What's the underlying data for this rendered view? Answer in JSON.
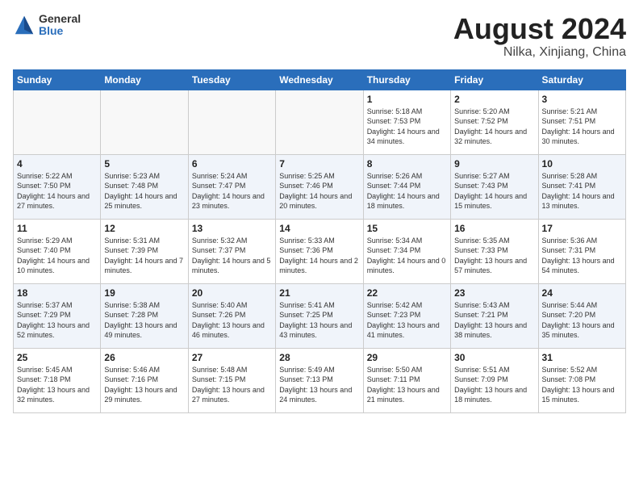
{
  "header": {
    "logo_general": "General",
    "logo_blue": "Blue",
    "month_year": "August 2024",
    "location": "Nilka, Xinjiang, China"
  },
  "days_of_week": [
    "Sunday",
    "Monday",
    "Tuesday",
    "Wednesday",
    "Thursday",
    "Friday",
    "Saturday"
  ],
  "weeks": [
    [
      {
        "day": "",
        "empty": true
      },
      {
        "day": "",
        "empty": true
      },
      {
        "day": "",
        "empty": true
      },
      {
        "day": "",
        "empty": true
      },
      {
        "day": "1",
        "sunrise": "5:18 AM",
        "sunset": "7:53 PM",
        "daylight": "14 hours and 34 minutes."
      },
      {
        "day": "2",
        "sunrise": "5:20 AM",
        "sunset": "7:52 PM",
        "daylight": "14 hours and 32 minutes."
      },
      {
        "day": "3",
        "sunrise": "5:21 AM",
        "sunset": "7:51 PM",
        "daylight": "14 hours and 30 minutes."
      }
    ],
    [
      {
        "day": "4",
        "sunrise": "5:22 AM",
        "sunset": "7:50 PM",
        "daylight": "14 hours and 27 minutes."
      },
      {
        "day": "5",
        "sunrise": "5:23 AM",
        "sunset": "7:48 PM",
        "daylight": "14 hours and 25 minutes."
      },
      {
        "day": "6",
        "sunrise": "5:24 AM",
        "sunset": "7:47 PM",
        "daylight": "14 hours and 23 minutes."
      },
      {
        "day": "7",
        "sunrise": "5:25 AM",
        "sunset": "7:46 PM",
        "daylight": "14 hours and 20 minutes."
      },
      {
        "day": "8",
        "sunrise": "5:26 AM",
        "sunset": "7:44 PM",
        "daylight": "14 hours and 18 minutes."
      },
      {
        "day": "9",
        "sunrise": "5:27 AM",
        "sunset": "7:43 PM",
        "daylight": "14 hours and 15 minutes."
      },
      {
        "day": "10",
        "sunrise": "5:28 AM",
        "sunset": "7:41 PM",
        "daylight": "14 hours and 13 minutes."
      }
    ],
    [
      {
        "day": "11",
        "sunrise": "5:29 AM",
        "sunset": "7:40 PM",
        "daylight": "14 hours and 10 minutes."
      },
      {
        "day": "12",
        "sunrise": "5:31 AM",
        "sunset": "7:39 PM",
        "daylight": "14 hours and 7 minutes."
      },
      {
        "day": "13",
        "sunrise": "5:32 AM",
        "sunset": "7:37 PM",
        "daylight": "14 hours and 5 minutes."
      },
      {
        "day": "14",
        "sunrise": "5:33 AM",
        "sunset": "7:36 PM",
        "daylight": "14 hours and 2 minutes."
      },
      {
        "day": "15",
        "sunrise": "5:34 AM",
        "sunset": "7:34 PM",
        "daylight": "14 hours and 0 minutes."
      },
      {
        "day": "16",
        "sunrise": "5:35 AM",
        "sunset": "7:33 PM",
        "daylight": "13 hours and 57 minutes."
      },
      {
        "day": "17",
        "sunrise": "5:36 AM",
        "sunset": "7:31 PM",
        "daylight": "13 hours and 54 minutes."
      }
    ],
    [
      {
        "day": "18",
        "sunrise": "5:37 AM",
        "sunset": "7:29 PM",
        "daylight": "13 hours and 52 minutes."
      },
      {
        "day": "19",
        "sunrise": "5:38 AM",
        "sunset": "7:28 PM",
        "daylight": "13 hours and 49 minutes."
      },
      {
        "day": "20",
        "sunrise": "5:40 AM",
        "sunset": "7:26 PM",
        "daylight": "13 hours and 46 minutes."
      },
      {
        "day": "21",
        "sunrise": "5:41 AM",
        "sunset": "7:25 PM",
        "daylight": "13 hours and 43 minutes."
      },
      {
        "day": "22",
        "sunrise": "5:42 AM",
        "sunset": "7:23 PM",
        "daylight": "13 hours and 41 minutes."
      },
      {
        "day": "23",
        "sunrise": "5:43 AM",
        "sunset": "7:21 PM",
        "daylight": "13 hours and 38 minutes."
      },
      {
        "day": "24",
        "sunrise": "5:44 AM",
        "sunset": "7:20 PM",
        "daylight": "13 hours and 35 minutes."
      }
    ],
    [
      {
        "day": "25",
        "sunrise": "5:45 AM",
        "sunset": "7:18 PM",
        "daylight": "13 hours and 32 minutes."
      },
      {
        "day": "26",
        "sunrise": "5:46 AM",
        "sunset": "7:16 PM",
        "daylight": "13 hours and 29 minutes."
      },
      {
        "day": "27",
        "sunrise": "5:48 AM",
        "sunset": "7:15 PM",
        "daylight": "13 hours and 27 minutes."
      },
      {
        "day": "28",
        "sunrise": "5:49 AM",
        "sunset": "7:13 PM",
        "daylight": "13 hours and 24 minutes."
      },
      {
        "day": "29",
        "sunrise": "5:50 AM",
        "sunset": "7:11 PM",
        "daylight": "13 hours and 21 minutes."
      },
      {
        "day": "30",
        "sunrise": "5:51 AM",
        "sunset": "7:09 PM",
        "daylight": "13 hours and 18 minutes."
      },
      {
        "day": "31",
        "sunrise": "5:52 AM",
        "sunset": "7:08 PM",
        "daylight": "13 hours and 15 minutes."
      }
    ]
  ]
}
